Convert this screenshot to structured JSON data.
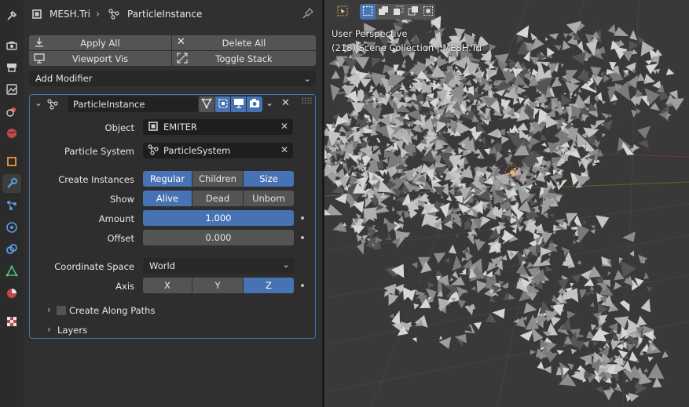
{
  "header": {
    "object_name": "MESH.Tri",
    "modifier_name": "ParticleInstance"
  },
  "toolbar": {
    "apply_all": "Apply All",
    "delete_all": "Delete All",
    "viewport_vis": "Viewport Vis",
    "toggle_stack": "Toggle Stack",
    "add_modifier": "Add Modifier"
  },
  "modifier": {
    "name": "ParticleInstance",
    "object": {
      "label": "Object",
      "value": "EMITER"
    },
    "particle_system": {
      "label": "Particle System",
      "value": "ParticleSystem"
    },
    "create_instances": {
      "label": "Create Instances",
      "options": [
        "Regular",
        "Children",
        "Size"
      ],
      "active": [
        "Regular",
        "Size"
      ]
    },
    "show": {
      "label": "Show",
      "options": [
        "Alive",
        "Dead",
        "Unborn"
      ],
      "active": [
        "Alive"
      ]
    },
    "amount": {
      "label": "Amount",
      "value": "1.000",
      "fraction": 1.0
    },
    "offset": {
      "label": "Offset",
      "value": "0.000",
      "fraction": 0.0
    },
    "coordinate_space": {
      "label": "Coordinate Space",
      "value": "World"
    },
    "axis": {
      "label": "Axis",
      "options": [
        "X",
        "Y",
        "Z"
      ],
      "active": [
        "Z"
      ]
    },
    "create_along_paths": {
      "label": "Create Along Paths",
      "checked": false
    },
    "layers": {
      "label": "Layers"
    }
  },
  "viewport": {
    "view_name": "User Perspective",
    "collection_info": "(218) Scene Collection | MESH.Tri"
  },
  "colors": {
    "accent": "#4772b3",
    "panel": "#303030",
    "widget": "#545454",
    "field": "#222222",
    "viewport": "#393939"
  }
}
